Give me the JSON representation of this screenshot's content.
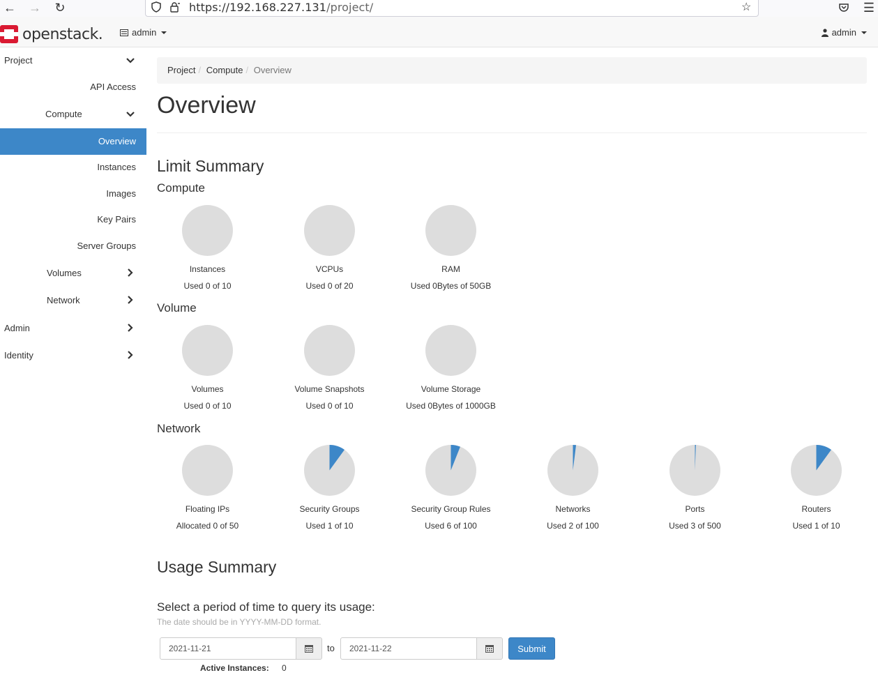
{
  "browser": {
    "url_host": "https://192.168.227.131",
    "url_path": "/project/"
  },
  "navbar": {
    "logo_text": "openstack.",
    "project_selector": "admin",
    "user_menu": "admin"
  },
  "sidebar": {
    "items": [
      {
        "label": "Project",
        "chevron": "down"
      },
      {
        "label": "API Access"
      },
      {
        "label": "Compute",
        "chevron": "down"
      },
      {
        "label": "Overview",
        "active": true
      },
      {
        "label": "Instances"
      },
      {
        "label": "Images"
      },
      {
        "label": "Key Pairs"
      },
      {
        "label": "Server Groups"
      },
      {
        "label": "Volumes",
        "chevron": "right"
      },
      {
        "label": "Network",
        "chevron": "right"
      },
      {
        "label": "Admin",
        "chevron": "right"
      },
      {
        "label": "Identity",
        "chevron": "right"
      }
    ]
  },
  "breadcrumb": [
    "Project",
    "Compute",
    "Overview"
  ],
  "page_title": "Overview",
  "limit_summary": {
    "heading": "Limit Summary",
    "sections": [
      {
        "title": "Compute",
        "charts": [
          {
            "title": "Instances",
            "text": "Used 0 of 10",
            "used": 0,
            "total": 10
          },
          {
            "title": "VCPUs",
            "text": "Used 0 of 20",
            "used": 0,
            "total": 20
          },
          {
            "title": "RAM",
            "text": "Used 0Bytes of 50GB",
            "used": 0,
            "total": 50
          }
        ]
      },
      {
        "title": "Volume",
        "charts": [
          {
            "title": "Volumes",
            "text": "Used 0 of 10",
            "used": 0,
            "total": 10
          },
          {
            "title": "Volume Snapshots",
            "text": "Used 0 of 10",
            "used": 0,
            "total": 10
          },
          {
            "title": "Volume Storage",
            "text": "Used 0Bytes of 1000GB",
            "used": 0,
            "total": 1000
          }
        ]
      },
      {
        "title": "Network",
        "charts": [
          {
            "title": "Floating IPs",
            "text": "Allocated 0 of 50",
            "used": 0,
            "total": 50
          },
          {
            "title": "Security Groups",
            "text": "Used 1 of 10",
            "used": 1,
            "total": 10
          },
          {
            "title": "Security Group Rules",
            "text": "Used 6 of 100",
            "used": 6,
            "total": 100
          },
          {
            "title": "Networks",
            "text": "Used 2 of 100",
            "used": 2,
            "total": 100
          },
          {
            "title": "Ports",
            "text": "Used 3 of 500",
            "used": 3,
            "total": 500
          },
          {
            "title": "Routers",
            "text": "Used 1 of 10",
            "used": 1,
            "total": 10
          }
        ]
      }
    ]
  },
  "usage_summary": {
    "heading": "Usage Summary",
    "question": "Select a period of time to query its usage:",
    "help": "The date should be in YYYY-MM-DD format.",
    "start_date": "2021-11-21",
    "to_label": "to",
    "end_date": "2021-11-22",
    "submit_label": "Submit",
    "active_instances_label": "Active Instances:",
    "active_instances_value": "0"
  },
  "colors": {
    "accent": "#3d87c8",
    "pie_bg": "#dddddd",
    "logo_red": "#da1a32"
  }
}
